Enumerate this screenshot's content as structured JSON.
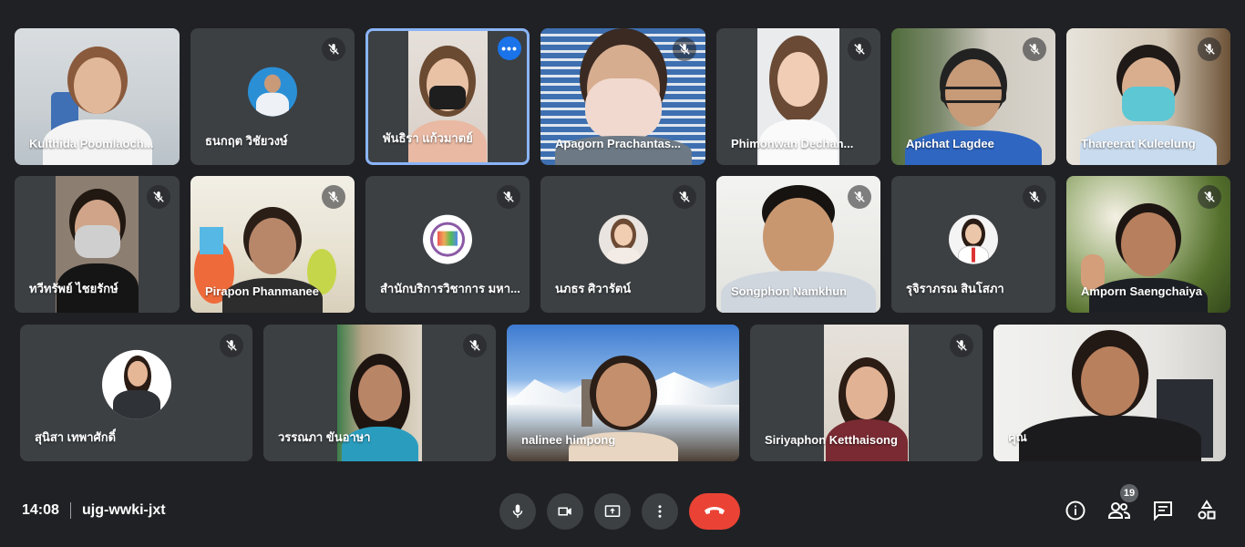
{
  "meeting": {
    "time": "14:08",
    "code": "ujg-wwki-jxt",
    "participant_count": "19"
  },
  "participants": [
    {
      "name": "Kulthida Poomlaoch...",
      "muted": false
    },
    {
      "name": "ธนกฤต วิชัยวงษ์",
      "muted": true
    },
    {
      "name": "พันธิรา แก้วมาตย์",
      "muted": false,
      "active": true
    },
    {
      "name": "Apagorn Prachantas...",
      "muted": true
    },
    {
      "name": "Phimonwan Dechan...",
      "muted": true
    },
    {
      "name": "Apichat Lagdee",
      "muted": true
    },
    {
      "name": "Thareerat Kuleelung",
      "muted": true
    },
    {
      "name": "ทวีทรัพย์ ไชยรักษ์",
      "muted": true
    },
    {
      "name": "Pirapon Phanmanee",
      "muted": true
    },
    {
      "name": "สำนักบริการวิชาการ มหา...",
      "muted": true
    },
    {
      "name": "นภธร ศิวารัตน์",
      "muted": true
    },
    {
      "name": "Songphon Namkhun",
      "muted": true
    },
    {
      "name": "รุจิราภรณ สินโสภา",
      "muted": true
    },
    {
      "name": "Amporn Saengchaiya",
      "muted": true
    },
    {
      "name": "สุนิสา เทพาศักดิ์",
      "muted": true
    },
    {
      "name": "วรรณภา ขันอาษา",
      "muted": true
    },
    {
      "name": "nalinee himpong",
      "muted": false
    },
    {
      "name": "Siriyaphon Ketthaisong",
      "muted": true
    },
    {
      "name": "คุณ",
      "muted": false
    }
  ],
  "colors": {
    "background": "#202124",
    "tile": "#3c4043",
    "active_border": "#8ab4f8",
    "end_call": "#ea4335",
    "more_button": "#1a73e8"
  },
  "icons": {
    "mic": "mic-icon",
    "camera": "camera-icon",
    "present": "present-screen-icon",
    "more": "more-vert-icon",
    "end_call": "end-call-icon",
    "info": "info-icon",
    "people": "people-icon",
    "chat": "chat-icon",
    "activities": "activities-icon"
  }
}
